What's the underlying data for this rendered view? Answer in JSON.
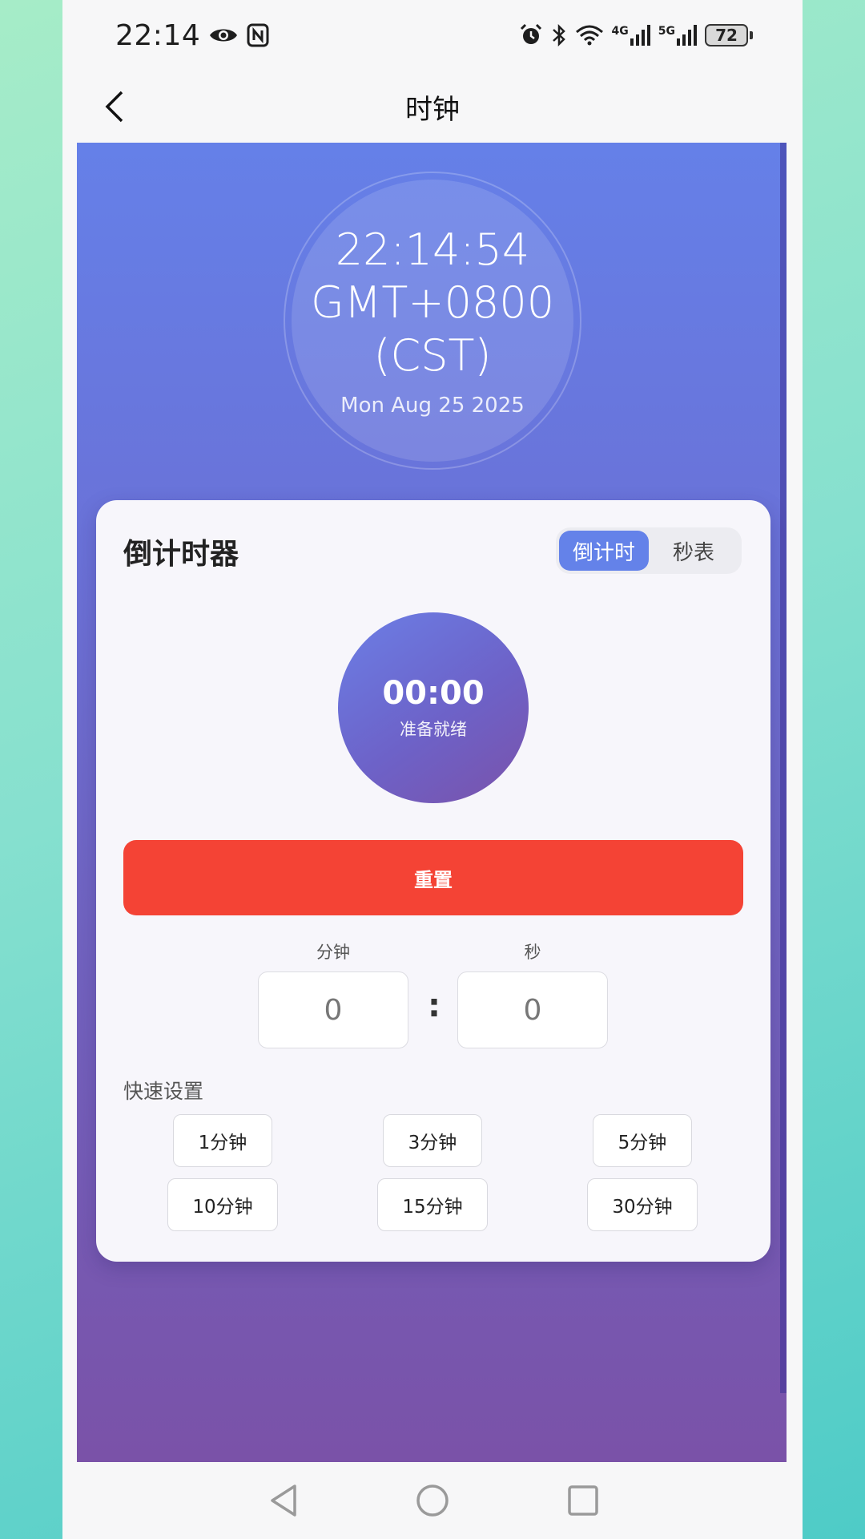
{
  "status_bar": {
    "time": "22:14",
    "net1": "4G",
    "net2": "5G",
    "battery": "72"
  },
  "header": {
    "title": "时钟"
  },
  "clock": {
    "time_line1": "22:14:54",
    "time_line2": "GMT+0800",
    "time_line3": "(CST)",
    "date": "Mon Aug 25 2025"
  },
  "card": {
    "title": "倒计时器",
    "toggle": {
      "countdown": "倒计时",
      "stopwatch": "秒表"
    },
    "timer": {
      "value": "00:00",
      "status": "准备就绪"
    },
    "reset_label": "重置",
    "minutes_label": "分钟",
    "seconds_label": "秒",
    "minutes_value": "0",
    "seconds_value": "0",
    "colon": ":",
    "quick_label": "快速设置",
    "presets": [
      "1分钟",
      "3分钟",
      "5分钟",
      "10分钟",
      "15分钟",
      "30分钟"
    ]
  },
  "colors": {
    "accent": "#6482e9",
    "reset": "#f44335"
  }
}
